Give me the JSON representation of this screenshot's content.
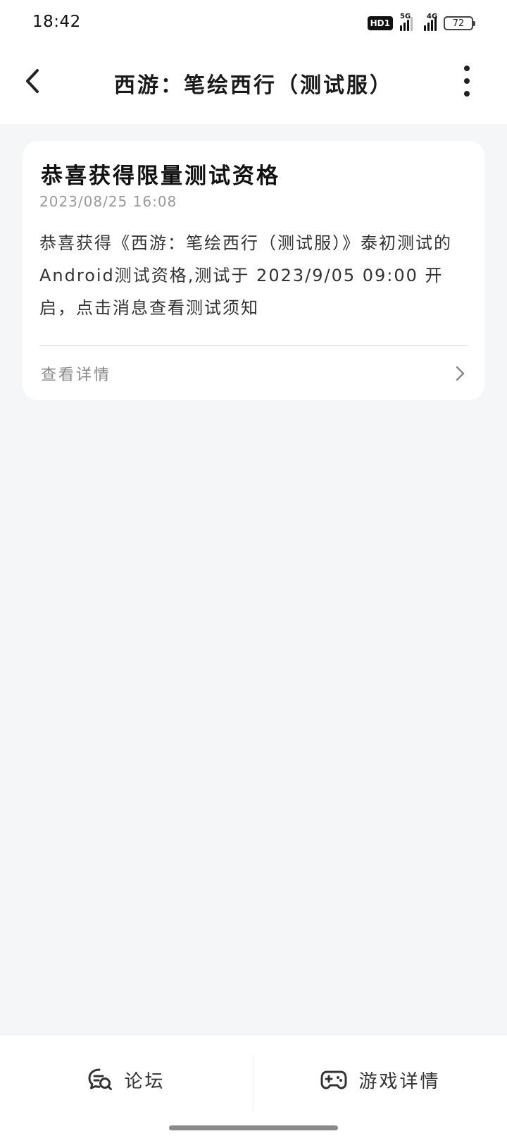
{
  "status_bar": {
    "time": "18:42",
    "hd_label": "HD1",
    "signal_5g": "5G",
    "signal_4g": "4G",
    "battery": "72"
  },
  "header": {
    "title": "西游：笔绘西行（测试服）",
    "back_icon": "chevron-left-icon",
    "more_icon": "more-vertical-icon"
  },
  "message": {
    "title": "恭喜获得限量测试资格",
    "time": "2023/08/25 16:08",
    "body": "恭喜获得《西游：笔绘西行（测试服）》泰初测试的Android测试资格,测试于 2023/9/05 09:00 开启，点击消息查看测试须知",
    "link_label": "查看详情"
  },
  "bottom_bar": {
    "forum_label": "论坛",
    "game_label": "游戏详情",
    "forum_icon": "forum-icon",
    "game_icon": "gamepad-icon"
  }
}
